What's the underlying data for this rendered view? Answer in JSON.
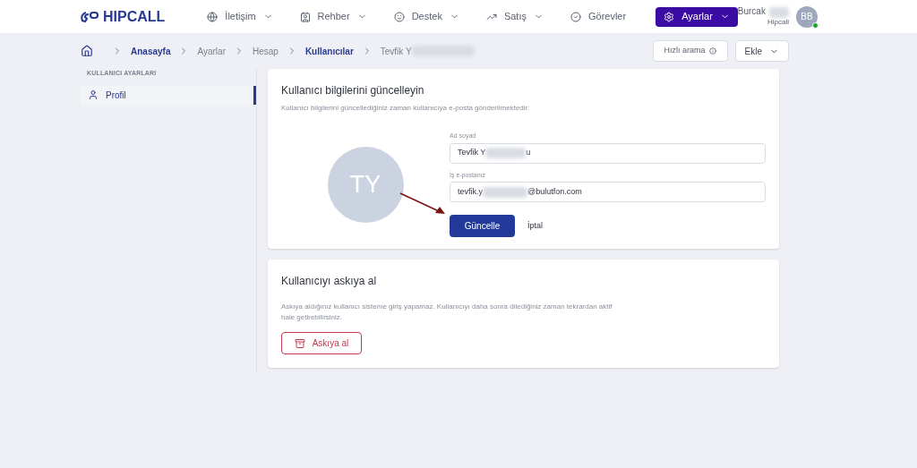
{
  "logo": {
    "text": "HIPCALL"
  },
  "nav": [
    {
      "label": "İletişim",
      "kind": "menu",
      "selected": false
    },
    {
      "label": "Rehber",
      "kind": "menu",
      "selected": false
    },
    {
      "label": "Destek",
      "kind": "menu",
      "selected": false
    },
    {
      "label": "Satış",
      "kind": "menu",
      "selected": false
    },
    {
      "label": "Görevler",
      "kind": "link",
      "selected": false
    },
    {
      "label": "Ayarlar",
      "kind": "menu",
      "selected": true
    }
  ],
  "user": {
    "name": "Burcak",
    "company": "Hipcall",
    "initials": "BB",
    "online": true
  },
  "breadcrumb": [
    {
      "label": "Anasayfa",
      "link": true
    },
    {
      "label": "Ayarlar",
      "link": false
    },
    {
      "label": "Hesap",
      "link": false
    },
    {
      "label": "Kullanıcılar",
      "link": true
    },
    {
      "label": "Tevfik Y",
      "link": false
    }
  ],
  "actions": {
    "quick_call": "Hızlı arama",
    "add": "Ekle"
  },
  "sidebar": {
    "heading": "KULLANICI AYARLARI",
    "items": [
      {
        "label": "Profil",
        "selected": true
      }
    ]
  },
  "profile_card": {
    "title": "Kullanıcı bilgilerini güncelleyin",
    "subtitle": "Kullanıcı bilgilerini güncellediğiniz zaman kullanıcıya e-posta gönderilmektedir.",
    "avatar": "TY",
    "fields": [
      {
        "label": "Ad soyad",
        "value_start": "Tevfik Y",
        "value_end": "u"
      },
      {
        "label": "İş e-postanız",
        "value_start": "tevfik.y",
        "value_end": "@bulutfon.com"
      }
    ],
    "save": "Güncelle",
    "cancel": "İptal"
  },
  "suspend_card": {
    "title": "Kullanıcıyı askıya al",
    "text": "Askıya aldığınız kullanıcı sisteme giriş yapamaz. Kullanıcıyı daha sonra dilediğiniz zaman tekrardan aktif hale getirebilirsiniz.",
    "button": "Askıya al"
  }
}
